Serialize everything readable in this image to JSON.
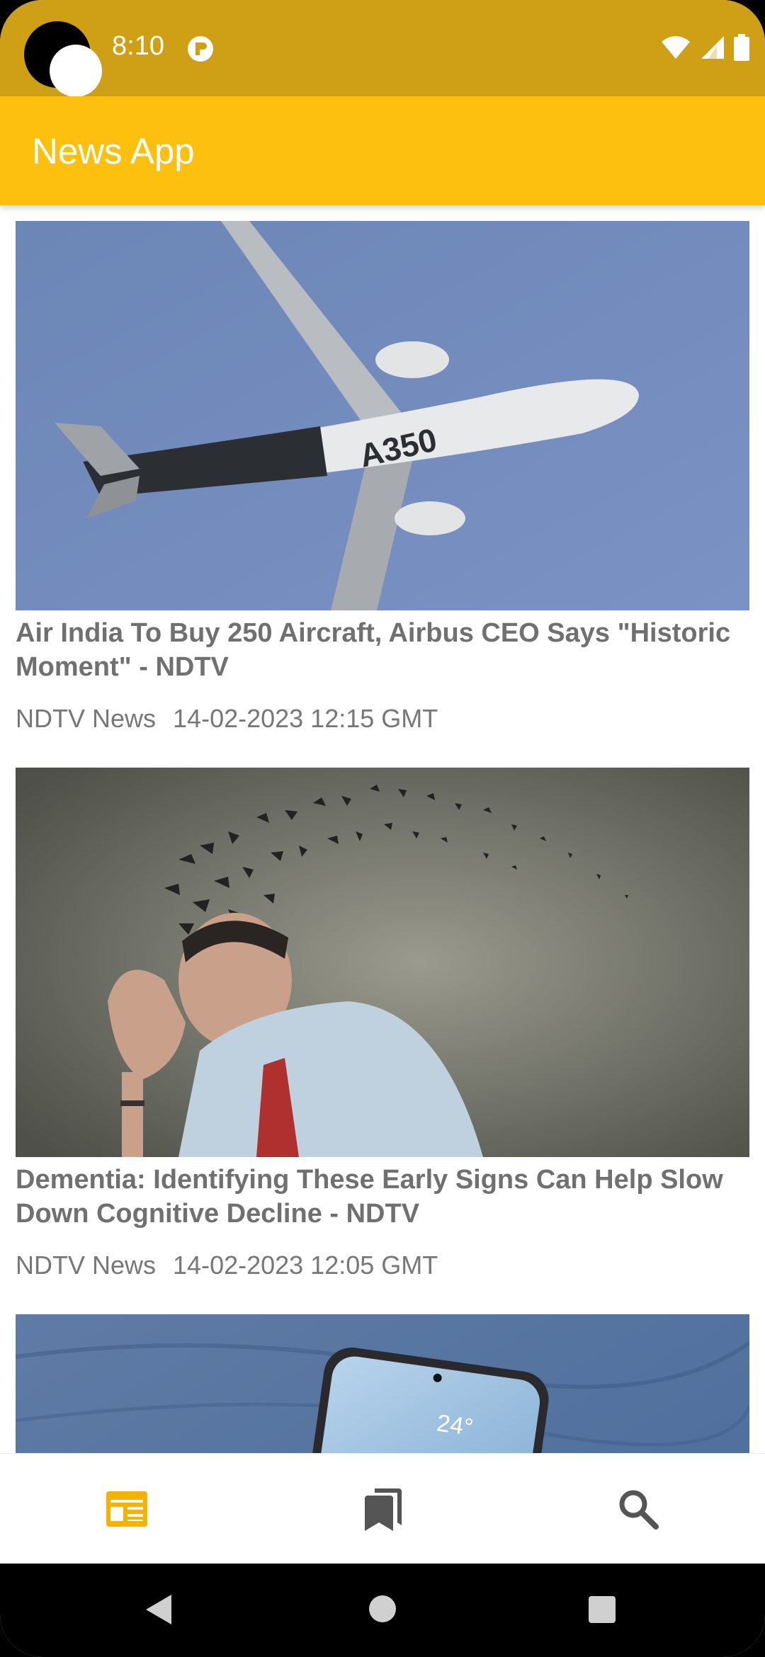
{
  "status_bar": {
    "time": "8:10",
    "icons": [
      "wifi-icon",
      "cellular-signal-icon",
      "battery-icon"
    ]
  },
  "app_bar": {
    "title": "News App"
  },
  "articles": [
    {
      "image_subject": "airplane",
      "title": "Air India To Buy 250 Aircraft, Airbus CEO Says \"Historic Moment\" - NDTV",
      "source": "NDTV News",
      "timestamp": "14-02-2023 12:15 GMT"
    },
    {
      "image_subject": "man with shattering head",
      "title": "Dementia: Identifying These Early Signs Can Help Slow Down Cognitive Decline - NDTV",
      "source": "NDTV News",
      "timestamp": "14-02-2023 12:05 GMT"
    },
    {
      "image_subject": "phone on denim",
      "phone_text": "24°"
    }
  ],
  "bottom_nav": {
    "items": [
      {
        "icon": "news-feed-icon",
        "active": true
      },
      {
        "icon": "bookmarks-icon",
        "active": false
      },
      {
        "icon": "search-icon",
        "active": false
      }
    ],
    "active_color": "#F5B300",
    "inactive_color": "#555555"
  },
  "colors": {
    "status_bar": "#CFA015",
    "app_bar": "#FDC00E"
  }
}
